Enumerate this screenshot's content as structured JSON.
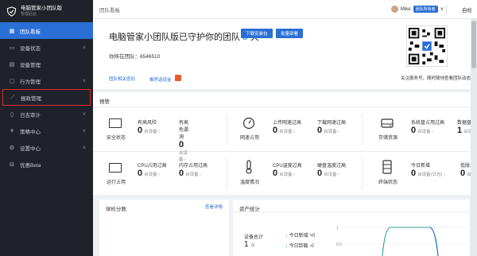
{
  "sidebar": {
    "brand_title": "电脑管家小团队版",
    "brand_subtitle": "管理后台",
    "items": [
      {
        "label": "团队看板",
        "icon": "grid-icon",
        "arrow": ""
      },
      {
        "label": "设备状态",
        "icon": "monitor-icon",
        "arrow": "∨"
      },
      {
        "label": "设备管理",
        "icon": "device-list-icon",
        "arrow": ""
      },
      {
        "label": "行为管理",
        "icon": "behavior-icon",
        "arrow": "∨"
      },
      {
        "label": "报政管理",
        "icon": "chart-line-icon",
        "arrow": ""
      },
      {
        "label": "日志审计",
        "icon": "log-icon",
        "arrow": "∨"
      },
      {
        "label": "策略中心",
        "icon": "policy-icon",
        "arrow": "∨"
      },
      {
        "label": "设置中心",
        "icon": "settings-icon",
        "arrow": "∨"
      },
      {
        "label": "优惠Beta",
        "icon": "coupon-icon",
        "arrow": ""
      }
    ]
  },
  "topbar": {
    "breadcrumb": "团队看板",
    "user_name": "Mike",
    "user_badge": "团队所有者",
    "user_arrow": "∨",
    "more": "自检"
  },
  "hero": {
    "title_prefix": "电脑管家小团队版已守护你的团队",
    "days": "5",
    "days_unit": "天",
    "download_btn": "下载安装包",
    "deploy_btn": "批量部署",
    "team_id": "你所在团队：6546510",
    "link_password": "团队相关密码",
    "link_cashback": "推荐返现金",
    "follow_text": "关注服务号，随时随地查看团队动态"
  },
  "alerts": {
    "title": "预警",
    "cells": [
      {
        "label": "安全状态",
        "m1_title": "有高风险",
        "m1_val": "0",
        "m1_unit": "台设备 ›",
        "m2_title": "有高危漏洞",
        "m2_val": "0",
        "m2_unit": "台设备 ›"
      },
      {
        "label": "网速占用",
        "m1_title": "上传网速过高",
        "m1_val": "0",
        "m1_unit": "台设备 ›",
        "m2_title": "下载网速过高",
        "m2_val": "0",
        "m2_unit": "台设备 ›"
      },
      {
        "label": "存储资源",
        "m1_title": "系统盘占用过高",
        "m1_val": "0",
        "m1_unit": "台设备 ›",
        "m2_title": "数据盘",
        "m2_val": "1",
        "m2_unit": "台设"
      },
      {
        "label": "运行占用",
        "m1_title": "CPU占用过高",
        "m1_val": "0",
        "m1_unit": "台设备 ›",
        "m2_title": "内存占用过高",
        "m2_val": "0",
        "m2_unit": "台设备 ›"
      },
      {
        "label": "温度情况",
        "m1_title": "CPU温度过高",
        "m1_val": "0",
        "m1_unit": "台设备 ›",
        "m2_title": "硬盘温度过高",
        "m2_val": "0",
        "m2_unit": "台设备 ›"
      },
      {
        "label": "终端状态",
        "m1_title": "今日新增",
        "m1_val": "0",
        "m1_unit": "台设备(日志) ›",
        "m2_title": "低版本",
        "m2_val": "0",
        "m2_unit": "台"
      }
    ]
  },
  "health": {
    "title": "体检分数",
    "link": "查看详情"
  },
  "assets": {
    "title": "资产统计",
    "total_label": "设备总计",
    "total_value": "1",
    "total_unit": "台",
    "today_new": "今日新增 +0",
    "today_uninstall": "今日卸载 -0",
    "chart_ticks": [
      "1",
      "0.5"
    ],
    "up_icon": "arrow-up-icon",
    "down_icon": "arrow-down-icon"
  }
}
